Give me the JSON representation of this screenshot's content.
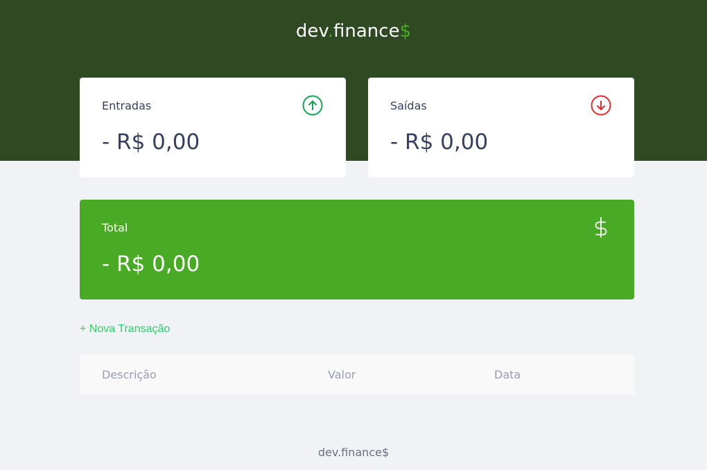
{
  "header": {
    "logo": {
      "part1": "dev",
      "dot": ".",
      "part2": "finance",
      "dollar": "$"
    }
  },
  "cards": {
    "income": {
      "title": "Entradas",
      "value": "- R$ 0,00",
      "icon": "arrow-up-circle-icon",
      "color": "#12a454"
    },
    "expense": {
      "title": "Saídas",
      "value": "- R$ 0,00",
      "icon": "arrow-down-circle-icon",
      "color": "#e92929"
    },
    "total": {
      "title": "Total",
      "value": "- R$ 0,00",
      "icon": "dollar-sign-icon",
      "color": "#ffffff"
    }
  },
  "actions": {
    "new_transaction": "+ Nova Transação"
  },
  "table": {
    "columns": [
      "Descrição",
      "Valor",
      "Data"
    ]
  },
  "footer": {
    "text": "dev.finance$"
  },
  "colors": {
    "header_bg": "#2f4a22",
    "accent": "#49aa26",
    "page_bg": "#f0f2f5"
  }
}
